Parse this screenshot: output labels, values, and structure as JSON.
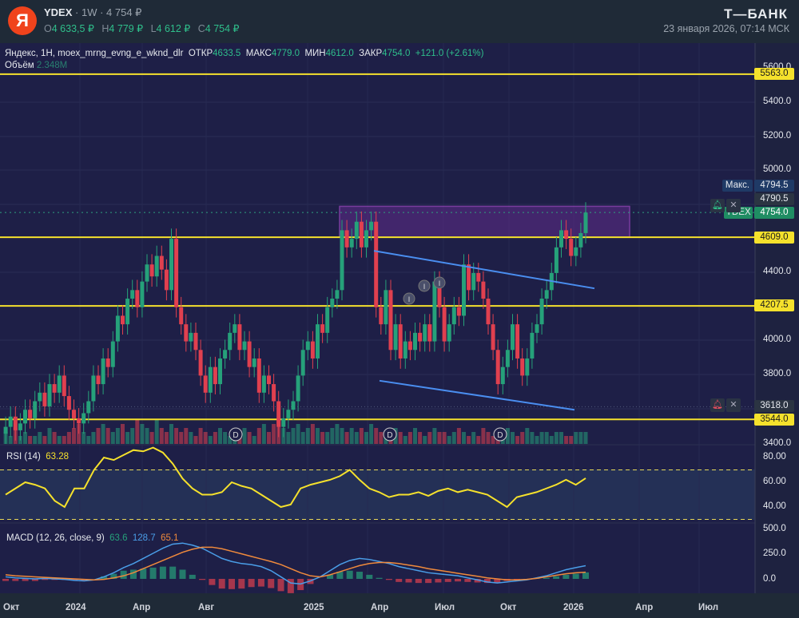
{
  "header": {
    "logo_letter": "Я",
    "symbol": "YDEX",
    "interval": "1W",
    "price": "4 754 ₽",
    "ohlc": [
      {
        "k": "O",
        "v": "4 633,5 ₽"
      },
      {
        "k": "H",
        "v": "4 779 ₽"
      },
      {
        "k": "L",
        "v": "4 612 ₽"
      },
      {
        "k": "C",
        "v": "4 754 ₽"
      }
    ],
    "brand": "Т—БАНК",
    "datetime": "23 января 2026, 07:14 МСК"
  },
  "legend": {
    "title": "Яндекс, 1H, moex_mrng_evng_e_wknd_dlr",
    "open_k": "ОТКР",
    "open": "4633.5",
    "high_k": "МАКС",
    "high": "4779.0",
    "low_k": "МИН",
    "low": "4612.0",
    "close_k": "ЗАКР",
    "close": "4754.0",
    "change": "+121.0 (+2.61%)",
    "volume_k": "Объём",
    "volume": "2.348M"
  },
  "price_axis": [
    "5600.0",
    "5400.0",
    "5200.0",
    "5000.0",
    "4400.0",
    "4000.0",
    "3800.0",
    "3400.0"
  ],
  "levels": [
    "5563.0",
    "4609.0",
    "4207.5",
    "3544.0"
  ],
  "badges": {
    "max_label": "Макс.",
    "max": "4794.5",
    "alert": "4790.5",
    "sym": "YDEX",
    "last": "4754.0",
    "alert2": "3618.0"
  },
  "rsi": {
    "label": "RSI (14)",
    "value": "63.28",
    "axis": [
      "80.00",
      "60.00",
      "40.00"
    ]
  },
  "macd": {
    "label": "MACD (12, 26, close, 9)",
    "hist": "63.6",
    "macd": "128.7",
    "signal": "65.1",
    "axis": [
      "500.0",
      "250.0",
      "0.0"
    ]
  },
  "time_axis": [
    "Окт",
    "2024",
    "Апр",
    "Авг",
    "2025",
    "Апр",
    "Июл",
    "Окт",
    "2026",
    "Апр",
    "Июл"
  ],
  "markers": {
    "dividend": "D",
    "info": "I"
  },
  "colors": {
    "up": "#26a17a",
    "down": "#e0404f",
    "level": "#f5e12c",
    "trend": "#4a8ef0",
    "zone": "#b44fd6",
    "rsi": "#f5e12c",
    "macd": "#4a9ee8",
    "signal": "#f08a3c"
  },
  "chart_data": {
    "type": "candlestick",
    "closes": [
      3500,
      3560,
      3480,
      3520,
      3600,
      3550,
      3650,
      3700,
      3620,
      3750,
      3700,
      3800,
      3680,
      3600,
      3550,
      3520,
      3580,
      3650,
      3800,
      3750,
      3900,
      3850,
      4000,
      4150,
      4100,
      4250,
      4300,
      4200,
      4350,
      4450,
      4380,
      4500,
      4420,
      4300,
      4600,
      4200,
      4100,
      4000,
      4050,
      3950,
      3800,
      3700,
      3850,
      3750,
      3900,
      3950,
      4050,
      4100,
      3950,
      4000,
      3850,
      3900,
      3700,
      3800,
      3750,
      3650,
      3500,
      3550,
      3600,
      3650,
      3800,
      3950,
      4000,
      3900,
      4100,
      4050,
      4200,
      4250,
      4300,
      4650,
      4550,
      4600,
      4700,
      4550,
      4650,
      4700,
      4200,
      4100,
      4300,
      3950,
      4100,
      3900,
      4000,
      3950,
      4050,
      4000,
      4100,
      4000,
      4350,
      4200,
      4000,
      4100,
      4200,
      4150,
      4450,
      4300,
      4400,
      4350,
      4250,
      4100,
      3950,
      3750,
      3850,
      3950,
      4100,
      3900,
      3800,
      3900,
      4050,
      4100,
      4250,
      4300,
      4400,
      4550,
      4650,
      4600,
      4500,
      4550,
      4633.5,
      4754
    ],
    "volume": [
      3,
      2,
      4,
      2,
      3,
      2,
      2,
      3,
      2,
      4,
      3,
      2,
      2,
      3,
      4,
      5,
      3,
      2,
      3,
      4,
      5,
      4,
      3,
      4,
      5,
      3,
      4,
      6,
      5,
      4,
      3,
      6,
      4,
      3,
      5,
      4,
      3,
      4,
      3,
      2,
      4,
      3,
      2,
      3,
      4,
      3,
      2,
      3,
      2,
      4,
      3,
      2,
      4,
      5,
      3,
      5,
      6,
      4,
      3,
      4,
      5,
      3,
      4,
      5,
      4,
      3,
      3,
      4,
      5,
      4,
      3,
      4,
      3,
      4,
      3,
      5,
      4,
      3,
      2,
      3,
      4,
      3,
      2,
      3,
      4,
      3,
      2,
      3,
      4,
      3,
      3,
      2,
      3,
      4,
      3,
      2,
      3,
      2,
      4,
      3,
      2,
      3,
      3,
      4,
      3,
      2,
      3,
      4,
      3,
      2,
      3,
      3,
      2,
      3,
      3,
      2,
      2,
      3,
      3,
      3
    ],
    "rsi": [
      50,
      55,
      60,
      58,
      55,
      45,
      40,
      55,
      55,
      70,
      80,
      78,
      82,
      86,
      85,
      88,
      84,
      75,
      63,
      55,
      50,
      50,
      52,
      60,
      57,
      55,
      50,
      45,
      40,
      42,
      55,
      58,
      60,
      62,
      65,
      70,
      62,
      55,
      52,
      48,
      50,
      50,
      52,
      49,
      53,
      55,
      52,
      54,
      52,
      50,
      45,
      40,
      48,
      50,
      52,
      55,
      58,
      62,
      58,
      63.28
    ],
    "rsi_levels": [
      70,
      30
    ],
    "macd": [
      20,
      10,
      5,
      0,
      5,
      0,
      -5,
      -15,
      -20,
      -10,
      20,
      60,
      110,
      150,
      200,
      250,
      300,
      340,
      350,
      330,
      300,
      250,
      200,
      170,
      150,
      140,
      120,
      80,
      20,
      -40,
      -50,
      -20,
      20,
      80,
      140,
      180,
      200,
      190,
      170,
      150,
      120,
      100,
      80,
      60,
      50,
      40,
      30,
      10,
      -10,
      -30,
      -40,
      -30,
      -20,
      -10,
      10,
      30,
      60,
      90,
      110,
      128.7
    ],
    "signal": [
      40,
      30,
      25,
      20,
      15,
      10,
      5,
      0,
      -5,
      -10,
      -5,
      10,
      30,
      60,
      100,
      140,
      180,
      220,
      260,
      290,
      310,
      310,
      295,
      270,
      245,
      220,
      195,
      170,
      140,
      100,
      60,
      30,
      20,
      40,
      70,
      100,
      130,
      150,
      160,
      160,
      150,
      135,
      120,
      100,
      85,
      70,
      55,
      40,
      25,
      10,
      0,
      -10,
      -10,
      -5,
      5,
      20,
      35,
      50,
      60,
      65.1
    ],
    "price_range": [
      3400,
      5600
    ],
    "zone": [
      4609,
      4790
    ],
    "trendlines": [
      [
        4530,
        4310
      ],
      [
        3770,
        3600
      ]
    ]
  }
}
